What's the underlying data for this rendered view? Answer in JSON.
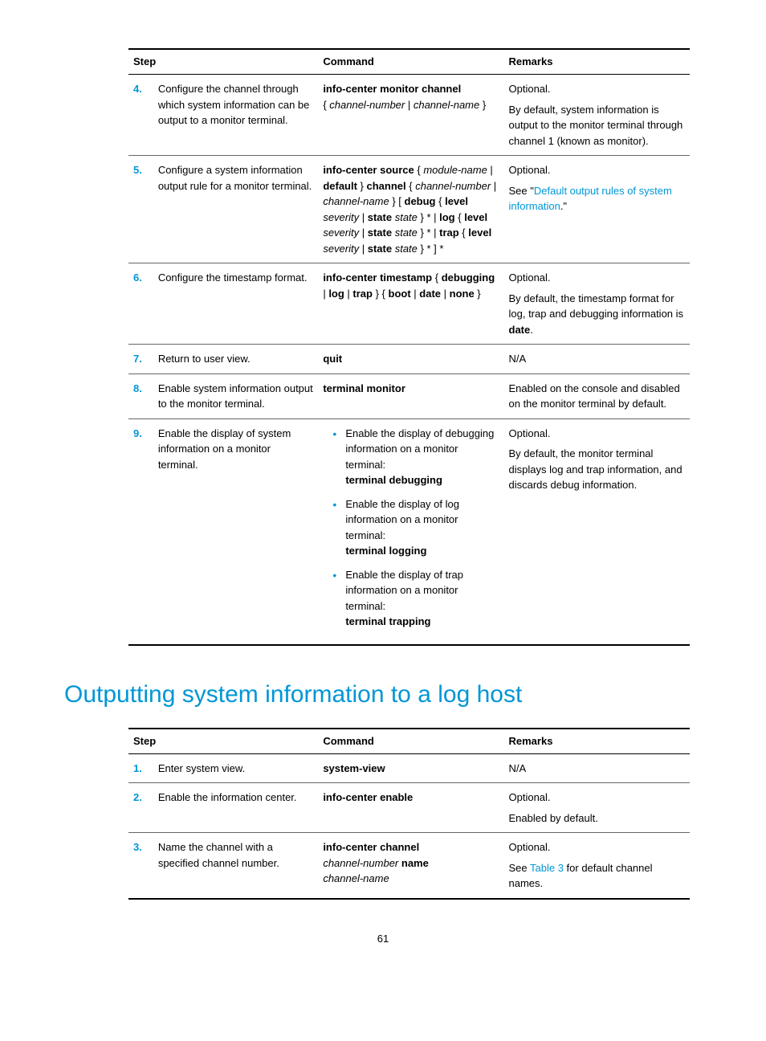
{
  "table1": {
    "headers": {
      "step": "Step",
      "command": "Command",
      "remarks": "Remarks"
    },
    "rows": [
      {
        "num": "4.",
        "desc": "Configure the channel through which system information can be output to a monitor terminal.",
        "cmd_parts": {
          "p1": "info-center monitor channel",
          "p2": "{ ",
          "p3": "channel-number",
          "p4": " | ",
          "p5": "channel-name",
          "p6": " }"
        },
        "rem": {
          "p1": "Optional.",
          "p2": "By default, system information is output to the monitor terminal through channel 1 (known as monitor)."
        }
      },
      {
        "num": "5.",
        "desc": "Configure a system information output rule for a monitor terminal.",
        "cmd_parts": {
          "a1": "info-center source",
          "a2": " { ",
          "a3": "module-name",
          "a4": " | ",
          "a5": "default",
          "a6": " } ",
          "a7": "channel",
          "a8": " { ",
          "a9": "channel-number",
          "a10": " | ",
          "a11": "channel-name",
          "a12": " } [ ",
          "a13": "debug",
          "a14": " { ",
          "a15": "level",
          "a16": " ",
          "a17": "severity",
          "a18": " | ",
          "a19": "state",
          "a20": " ",
          "a21": "state",
          "a22": " } * | ",
          "a23": "log",
          "a24": " { ",
          "a25": "level",
          "a26": " ",
          "a27": "severity",
          "a28": " | ",
          "a29": "state",
          "a30": " ",
          "a31": "state",
          "a32": " } * | ",
          "a33": "trap",
          "a34": " { ",
          "a35": "level",
          "a36": " ",
          "a37": "severity",
          "a38": " | ",
          "a39": "state",
          "a40": " ",
          "a41": "state",
          "a42": " } * ] *"
        },
        "rem": {
          "p1": "Optional.",
          "p2a": "See \"",
          "p2b": "Default output rules of system information",
          "p2c": ".\""
        }
      },
      {
        "num": "6.",
        "desc": "Configure the timestamp format.",
        "cmd_parts": {
          "b1": "info-center timestamp",
          "b2": " { ",
          "b3": "debugging",
          "b4": " | ",
          "b5": "log",
          "b6": " | ",
          "b7": "trap",
          "b8": " } { ",
          "b9": "boot",
          "b10": " | ",
          "b11": "date",
          "b12": " | ",
          "b13": "none",
          "b14": " }"
        },
        "rem": {
          "p1": "Optional.",
          "p2a": "By default, the timestamp format for log, trap and debugging information is ",
          "p2b": "date",
          "p2c": "."
        }
      },
      {
        "num": "7.",
        "desc": "Return to user view.",
        "cmd": "quit",
        "rem": "N/A"
      },
      {
        "num": "8.",
        "desc": "Enable system information output to the monitor terminal.",
        "cmd": "terminal monitor",
        "rem": "Enabled on the console and disabled on the monitor terminal by default."
      },
      {
        "num": "9.",
        "desc": "Enable the display of system information on a monitor terminal.",
        "bullets": [
          {
            "txt": "Enable the display of debugging information on a monitor terminal:",
            "cmd": "terminal debugging"
          },
          {
            "txt": "Enable the display of log information on a monitor terminal:",
            "cmd": "terminal logging"
          },
          {
            "txt": "Enable the display of trap information on a monitor terminal:",
            "cmd": "terminal trapping"
          }
        ],
        "rem": {
          "p1": "Optional.",
          "p2": "By default, the monitor terminal displays log and trap information, and discards debug information."
        }
      }
    ]
  },
  "heading": "Outputting system information to a log host",
  "table2": {
    "headers": {
      "step": "Step",
      "command": "Command",
      "remarks": "Remarks"
    },
    "rows": [
      {
        "num": "1.",
        "desc": "Enter system view.",
        "cmd": "system-view",
        "rem": "N/A"
      },
      {
        "num": "2.",
        "desc": "Enable the information center.",
        "cmd": "info-center enable",
        "rem": {
          "p1": "Optional.",
          "p2": "Enabled by default."
        }
      },
      {
        "num": "3.",
        "desc": "Name the channel with a specified channel number.",
        "cmd_parts": {
          "c1": "info-center channel",
          "c2": "channel-number",
          "c3": " ",
          "c4": "name",
          "c5": "channel-name"
        },
        "rem": {
          "p1": "Optional.",
          "p2a": "See ",
          "p2b": "Table 3",
          "p2c": " for default channel names."
        }
      }
    ]
  },
  "page_number": "61"
}
